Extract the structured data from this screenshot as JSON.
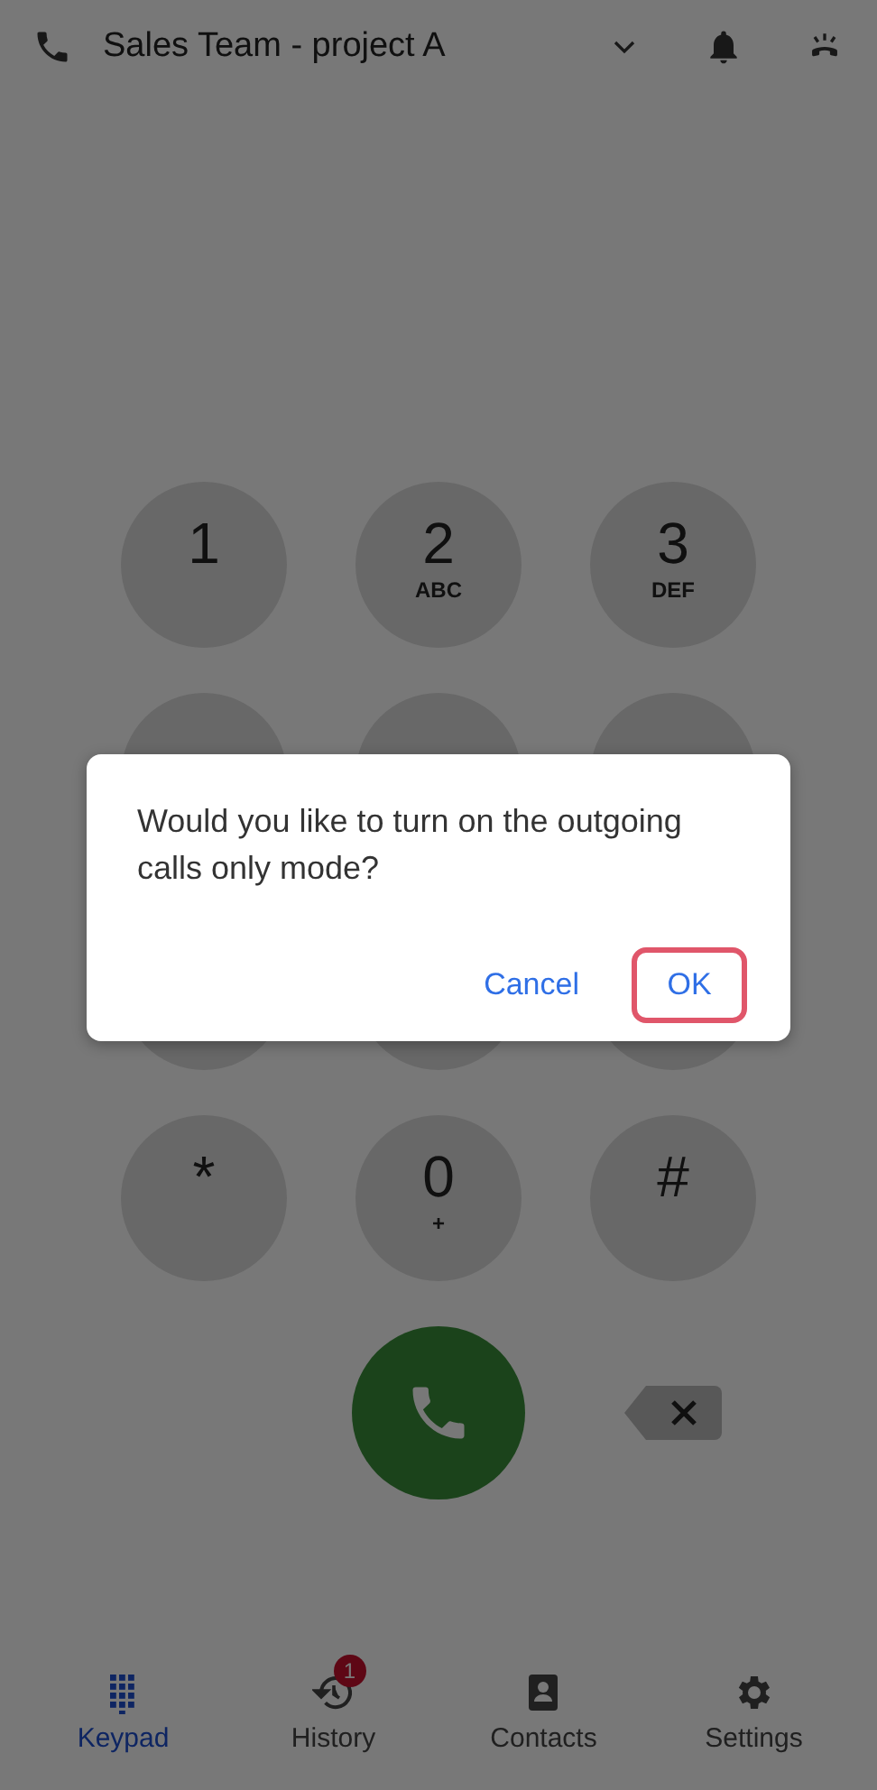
{
  "header": {
    "title": "Sales Team - project A"
  },
  "keypad": [
    {
      "kind": "digit",
      "digit": "1"
    },
    {
      "kind": "digit",
      "digit": "2",
      "letters": "ABC"
    },
    {
      "kind": "digit",
      "digit": "3",
      "letters": "DEF"
    },
    {
      "kind": "covered"
    },
    {
      "kind": "covered"
    },
    {
      "kind": "covered"
    },
    {
      "kind": "covered"
    },
    {
      "kind": "covered"
    },
    {
      "kind": "covered"
    },
    {
      "kind": "digit",
      "digit": "*"
    },
    {
      "kind": "digit",
      "digit": "0",
      "letters": "+"
    },
    {
      "kind": "digit",
      "digit": "#"
    }
  ],
  "dialog": {
    "message": "Would you like to turn on the outgoing calls only mode?",
    "buttons": [
      {
        "label": "Cancel",
        "highlighted": false
      },
      {
        "label": "OK",
        "highlighted": true
      }
    ]
  },
  "nav": [
    {
      "label": "Keypad",
      "selected": true
    },
    {
      "label": "History",
      "selected": false,
      "badge": "1"
    },
    {
      "label": "Contacts",
      "selected": false
    },
    {
      "label": "Settings",
      "selected": false
    }
  ]
}
